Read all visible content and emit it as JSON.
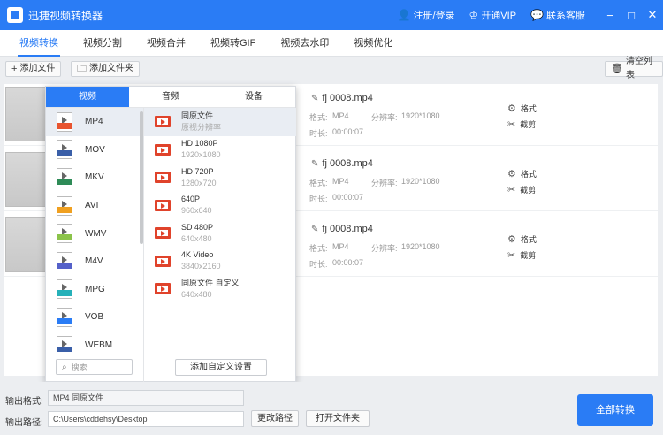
{
  "app": {
    "title": "迅捷视频转换器",
    "links": [
      {
        "label": "注册/登录",
        "icon": "user-icon"
      },
      {
        "label": "开通VIP",
        "icon": "crown-icon"
      },
      {
        "label": "联系客服",
        "icon": "chat-icon"
      }
    ]
  },
  "tabs": [
    "视频转换",
    "视频分割",
    "视频合并",
    "视频转GIF",
    "视频去水印",
    "视频优化"
  ],
  "toolbar": {
    "add_file": "添加文件",
    "add_folder": "添加文件夹",
    "clear_list": "清空列表"
  },
  "files": [
    {
      "name": "fj 0008.mp4",
      "format_label": "格式:",
      "format": "MP4",
      "res_label": "分辨率:",
      "resolution": "1920*1080",
      "duration_label": "时长:",
      "duration": "00:00:07",
      "format_action": "格式",
      "trim_action": "截剪"
    },
    {
      "name": "fj 0008.mp4",
      "format_label": "格式:",
      "format": "MP4",
      "res_label": "分辨率:",
      "resolution": "1920*1080",
      "duration_label": "时长:",
      "duration": "00:00:07",
      "format_action": "格式",
      "trim_action": "截剪"
    },
    {
      "name": "fj 0008.mp4",
      "format_label": "格式:",
      "format": "MP4",
      "res_label": "分辨率:",
      "resolution": "1920*1080",
      "duration_label": "时长:",
      "duration": "00:00:07",
      "format_action": "格式",
      "trim_action": "截剪"
    }
  ],
  "panel": {
    "tabs": [
      "视频",
      "音频",
      "设备"
    ],
    "formats": [
      {
        "label": "MP4",
        "color": "#e8542f"
      },
      {
        "label": "MOV",
        "color": "#3a5fa8"
      },
      {
        "label": "MKV",
        "color": "#2e8b57"
      },
      {
        "label": "AVI",
        "color": "#f0a020"
      },
      {
        "label": "WMV",
        "color": "#8bc34a"
      },
      {
        "label": "M4V",
        "color": "#5561c9"
      },
      {
        "label": "MPG",
        "color": "#26b1b9"
      },
      {
        "label": "VOB",
        "color": "#2a7cf5"
      },
      {
        "label": "WEBM",
        "color": "#3a5fa8"
      }
    ],
    "presets": [
      {
        "title": "同原文件",
        "sub": "原视分辨率"
      },
      {
        "title": "HD 1080P",
        "sub": "1920x1080"
      },
      {
        "title": "HD 720P",
        "sub": "1280x720"
      },
      {
        "title": "640P",
        "sub": "960x640"
      },
      {
        "title": "SD 480P",
        "sub": "640x480"
      },
      {
        "title": "4K Video",
        "sub": "3840x2160"
      },
      {
        "title": "同原文件 自定义",
        "sub": "640x480"
      }
    ],
    "search_placeholder": "搜索",
    "add_custom": "添加自定义设置"
  },
  "bottom": {
    "output_format_label": "输出格式:",
    "output_format_value": "MP4 同原文件",
    "output_path_label": "输出路径:",
    "output_path_value": "C:\\Users\\cddehsy\\Desktop",
    "change_path": "更改路径",
    "open_folder": "打开文件夹",
    "convert_all": "全部转换"
  }
}
